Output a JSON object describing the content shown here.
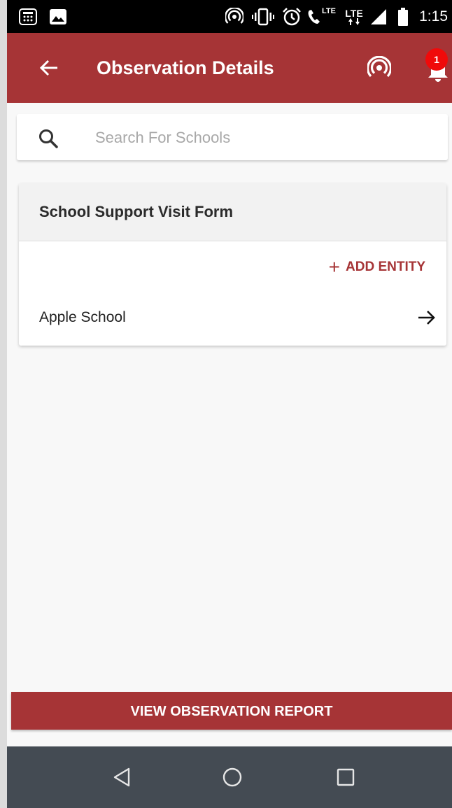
{
  "status_bar": {
    "time": "1:15",
    "lte_1": "LTE",
    "lte_2": "LTE",
    "icons": [
      "calculator-icon",
      "image-icon",
      "hotspot-icon",
      "vibrate-icon",
      "alarm-icon",
      "volte-call-icon",
      "lte-data-icon",
      "signal-icon",
      "battery-icon"
    ]
  },
  "app_bar": {
    "title": "Observation Details",
    "notification_count": "1",
    "color": "#a63436"
  },
  "search": {
    "placeholder": "Search For Schools",
    "value": ""
  },
  "observation": {
    "title": "School Support Visit Form",
    "add_entity_label": "ADD ENTITY",
    "entities": [
      {
        "name": "Apple School"
      }
    ]
  },
  "footer": {
    "report_button_label": "VIEW OBSERVATION REPORT"
  },
  "nav_bar": {
    "buttons": [
      "back-icon",
      "home-icon",
      "recents-icon"
    ]
  }
}
